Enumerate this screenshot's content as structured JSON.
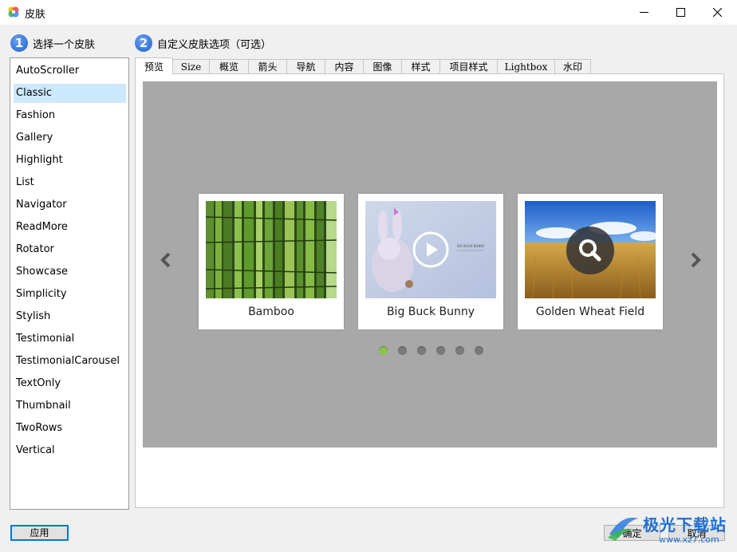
{
  "window": {
    "title": "皮肤",
    "controls": [
      "minimize-icon",
      "maximize-icon",
      "close-icon"
    ]
  },
  "step1": {
    "number": "1",
    "label": "选择一个皮肤"
  },
  "step2": {
    "number": "2",
    "label": "自定义皮肤选项（可选）"
  },
  "skins": {
    "selected": "Classic",
    "items": [
      "AutoScroller",
      "Classic",
      "Fashion",
      "Gallery",
      "Highlight",
      "List",
      "Navigator",
      "ReadMore",
      "Rotator",
      "Showcase",
      "Simplicity",
      "Stylish",
      "Testimonial",
      "TestimonialCarousel",
      "TextOnly",
      "Thumbnail",
      "TwoRows",
      "Vertical"
    ]
  },
  "tabs": {
    "active": "预览",
    "items": [
      "预览",
      "Size",
      "概览",
      "箭头",
      "导航",
      "内容",
      "图像",
      "样式",
      "项目样式",
      "Lightbox",
      "水印"
    ]
  },
  "preview": {
    "slides": [
      {
        "caption": "Bamboo",
        "overlay_icon": ""
      },
      {
        "caption": "Big Buck Bunny",
        "overlay_icon": "play-icon"
      },
      {
        "caption": "Golden Wheat Field",
        "overlay_icon": "search-icon"
      }
    ],
    "nav": {
      "prev_icon": "chevron-left-icon",
      "next_icon": "chevron-right-icon"
    },
    "pagination": {
      "count": 6,
      "active_index": 0
    },
    "inner_text": {
      "bunny_title": "BIG BUCK BUNNY"
    },
    "colors": {
      "background": "#a8a8a8",
      "dot_active": "#8bc34a",
      "dot_inactive": "#7a7a7a"
    }
  },
  "footer": {
    "apply": "应用",
    "ok": "确定",
    "cancel": "取消"
  },
  "watermark": {
    "text": "极光下载站",
    "url": "www.xz7.com"
  }
}
